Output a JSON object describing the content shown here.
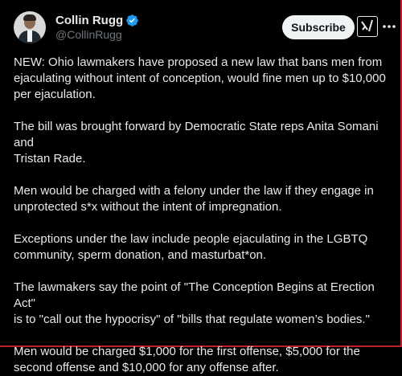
{
  "author": {
    "display_name": "Collin Rugg",
    "handle": "@CollinRugg",
    "verified_color": "#1d9bf0"
  },
  "actions": {
    "subscribe_label": "Subscribe",
    "grok_icon": "grok-icon",
    "more_icon": "more-icon"
  },
  "tweet": {
    "paragraphs": [
      "NEW: Ohio lawmakers have proposed a new law that bans men from\nejaculating without intent of conception, would fine men up to $10,000\nper ejaculation.",
      "The bill was brought forward by Democratic State reps Anita Somani and\nTristan Rade.",
      "Men would be charged with a felony under the law if they engage in\nunprotected s*x without the intent of impregnation.",
      "Exceptions under the law include people ejaculating in the LGBTQ\ncommunity, sperm donation, and masturbat*on.",
      "The lawmakers say the point of \"The Conception Begins at Erection Act\"\nis to \"call out the hypocrisy\" of \"bills that regulate women’s bodies.\"",
      "Men would be charged $1,000 for the first offense, $5,000 for the\nsecond offense and $10,000 for any offense after."
    ]
  }
}
